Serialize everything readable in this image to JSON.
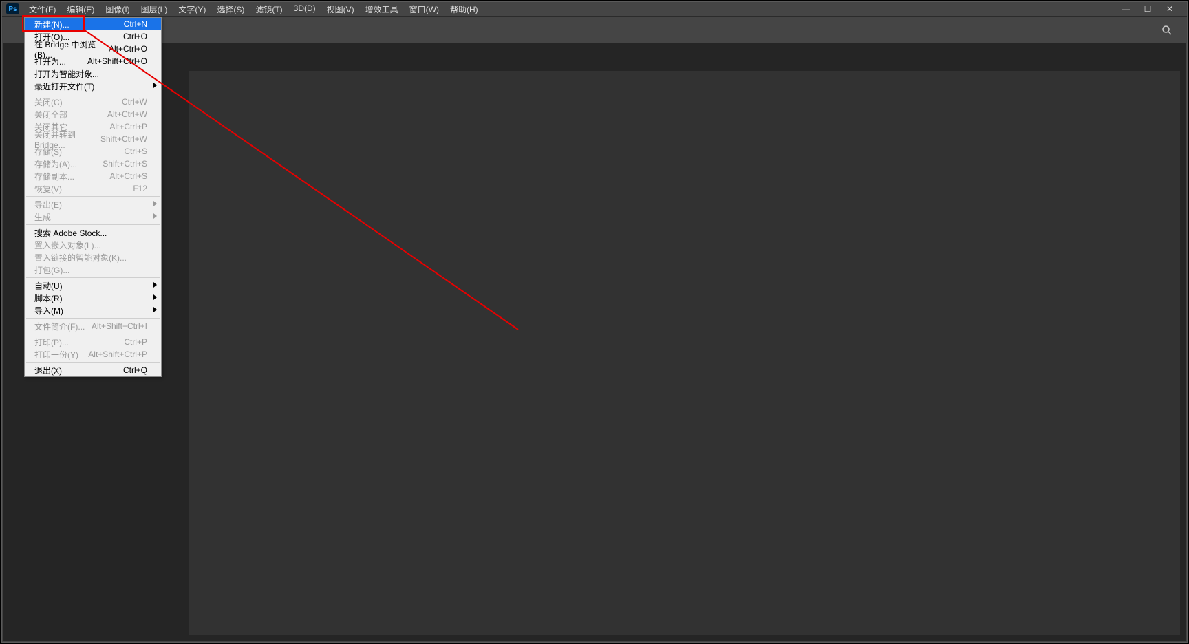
{
  "menubar": {
    "items": [
      "文件(F)",
      "编辑(E)",
      "图像(I)",
      "图层(L)",
      "文字(Y)",
      "选择(S)",
      "滤镜(T)",
      "3D(D)",
      "视图(V)",
      "增效工具",
      "窗口(W)",
      "帮助(H)"
    ]
  },
  "ps_badge": "Ps",
  "win": {
    "min": "—",
    "max": "☐",
    "close": "✕"
  },
  "search_icon": "🔍",
  "dropdown": {
    "groups": [
      [
        {
          "label": "新建(N)...",
          "shortcut": "Ctrl+N",
          "selected": true
        },
        {
          "label": "打开(O)...",
          "shortcut": "Ctrl+O"
        },
        {
          "label": "在 Bridge 中浏览(B)...",
          "shortcut": "Alt+Ctrl+O"
        },
        {
          "label": "打开为...",
          "shortcut": "Alt+Shift+Ctrl+O"
        },
        {
          "label": "打开为智能对象..."
        },
        {
          "label": "最近打开文件(T)",
          "submenu": true
        }
      ],
      [
        {
          "label": "关闭(C)",
          "shortcut": "Ctrl+W",
          "disabled": true
        },
        {
          "label": "关闭全部",
          "shortcut": "Alt+Ctrl+W",
          "disabled": true
        },
        {
          "label": "关闭其它",
          "shortcut": "Alt+Ctrl+P",
          "disabled": true
        },
        {
          "label": "关闭并转到 Bridge...",
          "shortcut": "Shift+Ctrl+W",
          "disabled": true
        },
        {
          "label": "存储(S)",
          "shortcut": "Ctrl+S",
          "disabled": true
        },
        {
          "label": "存储为(A)...",
          "shortcut": "Shift+Ctrl+S",
          "disabled": true
        },
        {
          "label": "存储副本...",
          "shortcut": "Alt+Ctrl+S",
          "disabled": true
        },
        {
          "label": "恢复(V)",
          "shortcut": "F12",
          "disabled": true
        }
      ],
      [
        {
          "label": "导出(E)",
          "submenu": true,
          "disabled": true
        },
        {
          "label": "生成",
          "submenu": true,
          "disabled": true
        }
      ],
      [
        {
          "label": "搜索 Adobe Stock..."
        },
        {
          "label": "置入嵌入对象(L)...",
          "disabled": true
        },
        {
          "label": "置入链接的智能对象(K)...",
          "disabled": true
        },
        {
          "label": "打包(G)...",
          "disabled": true
        }
      ],
      [
        {
          "label": "自动(U)",
          "submenu": true
        },
        {
          "label": "脚本(R)",
          "submenu": true
        },
        {
          "label": "导入(M)",
          "submenu": true
        }
      ],
      [
        {
          "label": "文件简介(F)...",
          "shortcut": "Alt+Shift+Ctrl+I",
          "disabled": true
        }
      ],
      [
        {
          "label": "打印(P)...",
          "shortcut": "Ctrl+P",
          "disabled": true
        },
        {
          "label": "打印一份(Y)",
          "shortcut": "Alt+Shift+Ctrl+P",
          "disabled": true
        }
      ],
      [
        {
          "label": "退出(X)",
          "shortcut": "Ctrl+Q"
        }
      ]
    ]
  }
}
